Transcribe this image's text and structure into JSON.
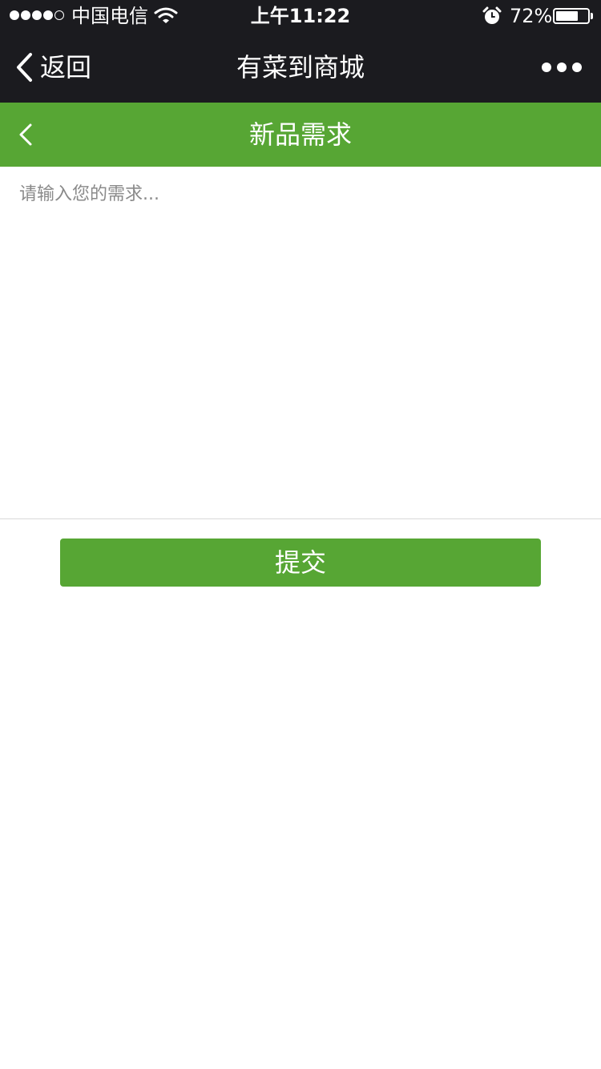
{
  "status_bar": {
    "carrier": "中国电信",
    "time": "上午11:22",
    "battery_percent": "72%",
    "battery_level": 0.72,
    "signal_bars_filled": 4,
    "signal_bars_total": 5
  },
  "nav": {
    "back_label": "返回",
    "title": "有菜到商城"
  },
  "page": {
    "title": "新品需求"
  },
  "form": {
    "placeholder": "请输入您的需求...",
    "value": "",
    "submit_label": "提交"
  },
  "colors": {
    "nav_background": "#1b1b1f",
    "brand_green": "#57a634"
  },
  "icons": [
    "signal-icon",
    "wifi-icon",
    "alarm-icon",
    "battery-icon",
    "back-chevron-icon",
    "more-icon"
  ]
}
